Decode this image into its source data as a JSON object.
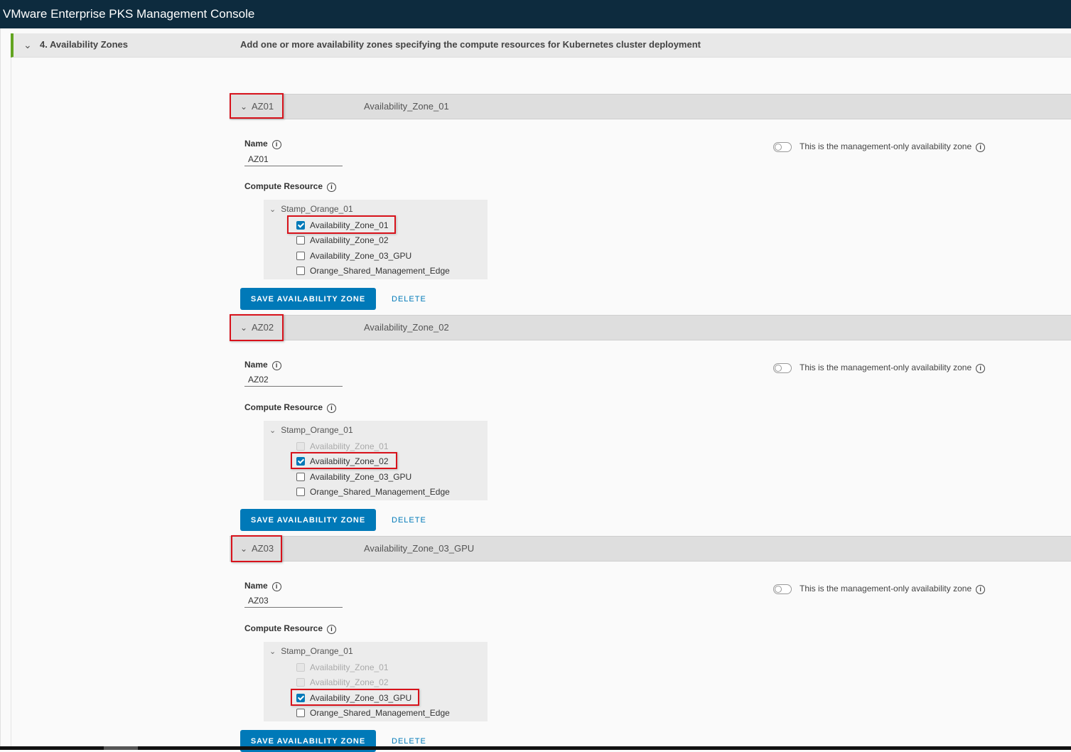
{
  "app": {
    "title": "VMware Enterprise PKS Management Console"
  },
  "step": {
    "title": "4. Availability Zones",
    "description": "Add one or more availability zones specifying the compute resources for Kubernetes cluster deployment"
  },
  "labels": {
    "name": "Name",
    "compute_resource": "Compute Resource",
    "management_only": "This is the management-only availability zone",
    "save": "SAVE AVAILABILITY ZONE",
    "delete": "DELETE",
    "info_glyph": "i"
  },
  "icons": {
    "chevron": "chevron-down-icon",
    "info": "info-icon"
  },
  "colors": {
    "topbar": "#0d2b3e",
    "accent": "#0079b8",
    "step_marker": "#62a420",
    "highlight": "#d8121b"
  },
  "zones": [
    {
      "id": "AZ01",
      "header_name": "Availability_Zone_01",
      "name_value": "AZ01",
      "management_only": false,
      "tree_root": "Stamp_Orange_01",
      "resources": [
        {
          "label": "Availability_Zone_01",
          "checked": true,
          "disabled": false
        },
        {
          "label": "Availability_Zone_02",
          "checked": false,
          "disabled": false
        },
        {
          "label": "Availability_Zone_03_GPU",
          "checked": false,
          "disabled": false
        },
        {
          "label": "Orange_Shared_Management_Edge",
          "checked": false,
          "disabled": false
        }
      ]
    },
    {
      "id": "AZ02",
      "header_name": "Availability_Zone_02",
      "name_value": "AZ02",
      "management_only": false,
      "tree_root": "Stamp_Orange_01",
      "resources": [
        {
          "label": "Availability_Zone_01",
          "checked": false,
          "disabled": true
        },
        {
          "label": "Availability_Zone_02",
          "checked": true,
          "disabled": false
        },
        {
          "label": "Availability_Zone_03_GPU",
          "checked": false,
          "disabled": false
        },
        {
          "label": "Orange_Shared_Management_Edge",
          "checked": false,
          "disabled": false
        }
      ]
    },
    {
      "id": "AZ03",
      "header_name": "Availability_Zone_03_GPU",
      "name_value": "AZ03",
      "management_only": false,
      "tree_root": "Stamp_Orange_01",
      "resources": [
        {
          "label": "Availability_Zone_01",
          "checked": false,
          "disabled": true
        },
        {
          "label": "Availability_Zone_02",
          "checked": false,
          "disabled": true
        },
        {
          "label": "Availability_Zone_03_GPU",
          "checked": true,
          "disabled": false
        },
        {
          "label": "Orange_Shared_Management_Edge",
          "checked": false,
          "disabled": false
        }
      ]
    }
  ]
}
